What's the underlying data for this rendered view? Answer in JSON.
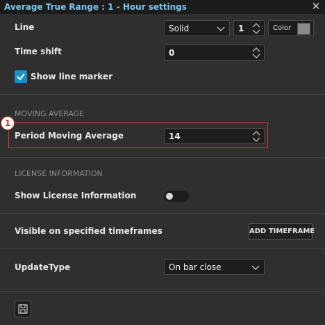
{
  "window": {
    "title": "Average True Range : 1 - Hour settings",
    "close_glyph": "✕"
  },
  "line": {
    "label": "Line",
    "style_value": "Solid",
    "width_value": "1",
    "color_label": "Color",
    "color_swatch": "#8a8a8a"
  },
  "time_shift": {
    "label": "Time shift",
    "value": "0"
  },
  "line_marker": {
    "label": "Show line marker",
    "checked": true
  },
  "moving_average": {
    "heading": "MOVING AVERAGE",
    "period_label": "Period Moving Average",
    "period_value": "14",
    "callout_number": "1"
  },
  "license": {
    "heading": "LICENSE INFORMATION",
    "show_label": "Show License Information",
    "enabled": false
  },
  "timeframes": {
    "label": "Visible on specified timeframes",
    "add_button": "ADD TIMEFRAME"
  },
  "update_type": {
    "label": "UpdateType",
    "value": "On bar close"
  },
  "icons": [
    "close-icon",
    "chevron-down-icon",
    "spinner-arrows-icon",
    "checkmark-icon",
    "save-icon"
  ],
  "colors": {
    "accent": "#1a8fc9",
    "title": "#7fc6ee",
    "highlight": "#d23a3a"
  }
}
